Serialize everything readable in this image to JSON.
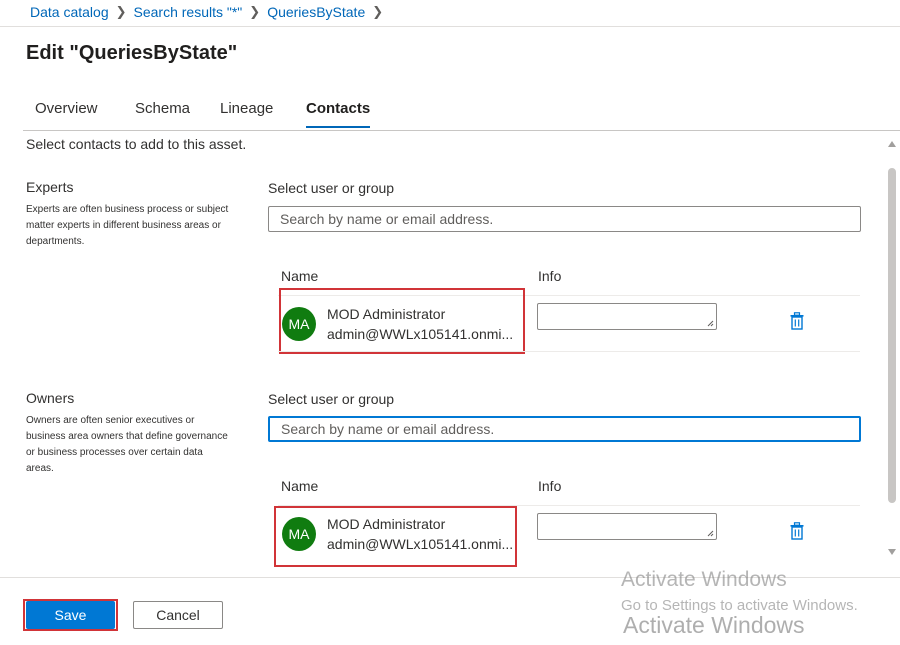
{
  "breadcrumb": {
    "items": [
      "Data catalog",
      "Search results \"*\"",
      "QueriesByState"
    ],
    "separator": ">"
  },
  "page_title": "Edit \"QueriesByState\"",
  "tabs": [
    {
      "label": "Overview",
      "active": false
    },
    {
      "label": "Schema",
      "active": false
    },
    {
      "label": "Lineage",
      "active": false
    },
    {
      "label": "Contacts",
      "active": true
    }
  ],
  "intro_text": "Select contacts to add to this asset.",
  "experts": {
    "title": "Experts",
    "description": "Experts are often business process or subject matter experts in different business areas or departments.",
    "select_label": "Select user or group",
    "search_placeholder": "Search by name or email address.",
    "col_name": "Name",
    "col_info": "Info",
    "contacts": [
      {
        "initials": "MA",
        "name": "MOD Administrator",
        "email": "admin@WWLx105141.onmi...",
        "info": ""
      }
    ]
  },
  "owners": {
    "title": "Owners",
    "description": "Owners are often senior executives or business area owners that define governance or business processes over certain data areas.",
    "select_label": "Select user or group",
    "search_placeholder": "Search by name or email address.",
    "col_name": "Name",
    "col_info": "Info",
    "contacts": [
      {
        "initials": "MA",
        "name": "MOD Administrator",
        "email": "admin@WWLx105141.onmi...",
        "info": ""
      }
    ]
  },
  "footer": {
    "save_label": "Save",
    "cancel_label": "Cancel"
  },
  "watermark": {
    "line1": "Activate Windows",
    "line2": "Go to Settings to activate Windows.",
    "line3": "Activate Windows"
  },
  "colors": {
    "accent": "#0078d4",
    "link": "#0067b8",
    "avatar": "#107c10",
    "highlight": "#d13438"
  },
  "icons": [
    "chevron-right-icon",
    "trash-icon",
    "scroll-up-icon",
    "scroll-down-icon"
  ]
}
